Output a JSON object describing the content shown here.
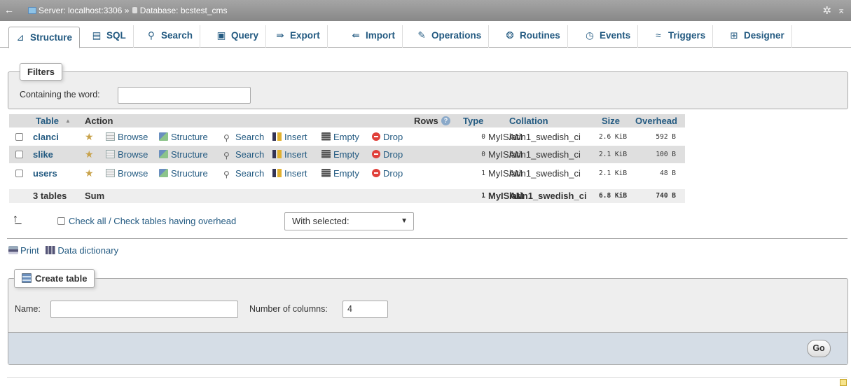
{
  "breadcrumb": {
    "back": "←",
    "server": "Server: localhost:3306",
    "sep": "»",
    "database": "Database: bcstest_cms"
  },
  "tabs": [
    {
      "label": "Structure",
      "icon": "structure-icon",
      "glyph": "⊿"
    },
    {
      "label": "SQL",
      "icon": "sql-icon",
      "glyph": "▤"
    },
    {
      "label": "Search",
      "icon": "search-icon",
      "glyph": "⚲"
    },
    {
      "label": "Query",
      "icon": "query-icon",
      "glyph": "▣"
    },
    {
      "label": "Export",
      "icon": "export-icon",
      "glyph": "⇛"
    },
    {
      "label": "Import",
      "icon": "import-icon",
      "glyph": "⇚"
    },
    {
      "label": "Operations",
      "icon": "wrench-icon",
      "glyph": "✎"
    },
    {
      "label": "Routines",
      "icon": "routines-icon",
      "glyph": "❂"
    },
    {
      "label": "Events",
      "icon": "clock-icon",
      "glyph": "◷"
    },
    {
      "label": "Triggers",
      "icon": "triggers-icon",
      "glyph": "≈"
    },
    {
      "label": "Designer",
      "icon": "designer-icon",
      "glyph": "⊞"
    }
  ],
  "filters": {
    "legend": "Filters",
    "label": "Containing the word:",
    "value": ""
  },
  "table": {
    "headers": {
      "table": "Table",
      "sort_glyph": "▲",
      "action": "Action",
      "rows": "Rows",
      "help_glyph": "?",
      "type": "Type",
      "collation": "Collation",
      "size": "Size",
      "overhead": "Overhead"
    },
    "actions": {
      "browse": "Browse",
      "structure": "Structure",
      "search": "Search",
      "insert": "Insert",
      "empty": "Empty",
      "drop": "Drop"
    },
    "rows": [
      {
        "name": "clanci",
        "rows": "0",
        "type": "MyISAM",
        "collation": "latin1_swedish_ci",
        "size": "2.6 KiB",
        "overhead": "592 B"
      },
      {
        "name": "slike",
        "rows": "0",
        "type": "MyISAM",
        "collation": "latin1_swedish_ci",
        "size": "2.1 KiB",
        "overhead": "100 B"
      },
      {
        "name": "users",
        "rows": "1",
        "type": "MyISAM",
        "collation": "latin1_swedish_ci",
        "size": "2.1 KiB",
        "overhead": "48 B"
      }
    ],
    "summary": {
      "name": "3 tables",
      "action": "Sum",
      "rows": "1",
      "type": "MyISAM",
      "collation": "latin1_swedish_ci",
      "size": "6.8 KiB",
      "overhead": "740 B"
    }
  },
  "bulk": {
    "check_all_label": "Check all / Check tables having overhead",
    "with_selected": "With selected:",
    "caret": "▼"
  },
  "links": {
    "print": "Print",
    "dictionary": "Data dictionary"
  },
  "create_table": {
    "legend": "Create table",
    "name_label": "Name:",
    "name_value": "",
    "columns_label": "Number of columns:",
    "columns_value": "4",
    "go": "Go"
  },
  "colors": {
    "link": "#235a81",
    "topbar": "#999999",
    "footer": "#d5dde6"
  }
}
